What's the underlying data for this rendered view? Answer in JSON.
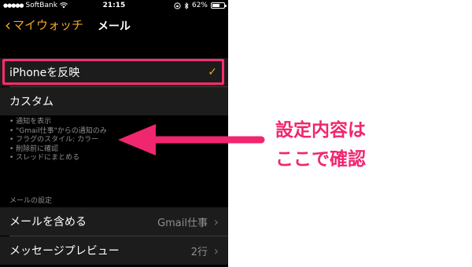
{
  "status": {
    "carrier": "SoftBank",
    "time": "21:15",
    "battery": "62%",
    "battery_level": 0.62
  },
  "nav": {
    "back_label": "マイウォッチ",
    "title": "メール"
  },
  "mirror_row": {
    "label": "iPhoneを反映",
    "selected": true
  },
  "custom_row": {
    "label": "カスタム"
  },
  "notes": [
    "• 通知を表示",
    "• \"Gmail仕事\"からの通知のみ",
    "• フラグのスタイル: カラー",
    "• 削除前に確認",
    "• スレッドにまとめる"
  ],
  "mail_settings": {
    "header": "メールの設定",
    "rows": [
      {
        "label": "メールを含める",
        "value": "Gmail仕事"
      },
      {
        "label": "メッセージプレビュー",
        "value": "2行"
      }
    ]
  },
  "annotation": {
    "line1": "設定内容は",
    "line2": "ここで確認"
  },
  "colors": {
    "accent": "#f5a623",
    "highlight": "#ff2d6e",
    "annotation": "#f0266f"
  }
}
